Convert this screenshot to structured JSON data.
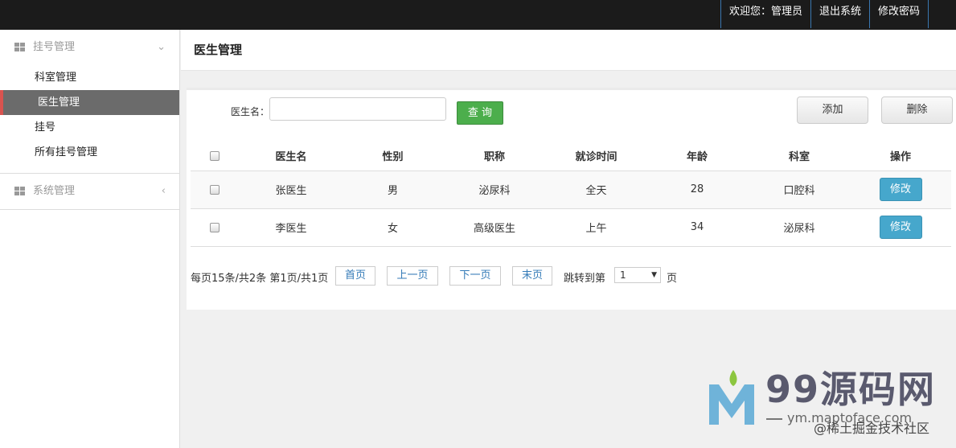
{
  "topbar": {
    "welcome": "欢迎您：管理员",
    "logout": "退出系统",
    "change_password": "修改密码"
  },
  "sidebar": {
    "group1": {
      "label": "挂号管理",
      "icon": "grid-icon",
      "arrow": "chevron-down-icon"
    },
    "items": [
      {
        "label": "科室管理"
      },
      {
        "label": "医生管理"
      },
      {
        "label": "挂号"
      },
      {
        "label": "所有挂号管理"
      }
    ],
    "group2": {
      "label": "系统管理",
      "icon": "grid-icon",
      "arrow": "chevron-left-icon"
    }
  },
  "page": {
    "title": "医生管理"
  },
  "search": {
    "label": "医生名：",
    "value": "",
    "query_button": "查 询"
  },
  "actions": {
    "add": "添加",
    "delete": "删除"
  },
  "table": {
    "headers": [
      "医生名",
      "性别",
      "职称",
      "就诊时间",
      "年龄",
      "科室",
      "操作"
    ],
    "rows": [
      {
        "name": "张医生",
        "gender": "男",
        "title": "泌尿科",
        "time": "全天",
        "age": "28",
        "dept": "口腔科",
        "edit": "修改"
      },
      {
        "name": "李医生",
        "gender": "女",
        "title": "高级医生",
        "time": "上午",
        "age": "34",
        "dept": "泌尿科",
        "edit": "修改"
      }
    ]
  },
  "pager": {
    "info": "每页15条/共2条 第1页/共1页",
    "first": "首页",
    "prev": "上一页",
    "next": "下一页",
    "last": "末页",
    "jump_label": "跳转到第",
    "selected_page": "1",
    "page_suffix": "页"
  },
  "watermark": {
    "brand": "99源码网",
    "url": "ym.maptoface.com",
    "community": "@稀土掘金技术社区"
  },
  "colors": {
    "topbar": "#1b1b1b",
    "active_menu": "#6b6b6b",
    "active_marker": "#d9534f",
    "query_button": "#4cae4c",
    "edit_button": "#46a7cc"
  }
}
